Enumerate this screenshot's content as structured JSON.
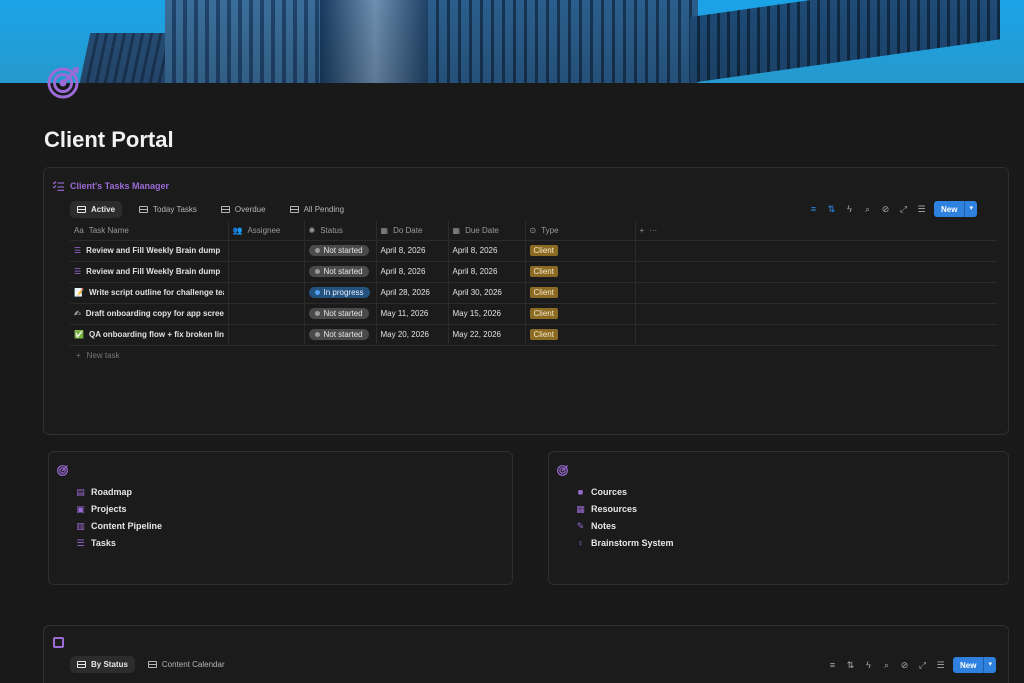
{
  "page": {
    "title": "Client Portal"
  },
  "tasks_db": {
    "title": "Client's Tasks Manager",
    "tabs": [
      {
        "label": "Active",
        "active": true
      },
      {
        "label": "Today Tasks",
        "active": false
      },
      {
        "label": "Overdue",
        "active": false
      },
      {
        "label": "All Pending",
        "active": false
      }
    ],
    "new_label": "New",
    "columns": {
      "name": "Task Name",
      "assignee": "Assignee",
      "status": "Status",
      "do_date": "Do Date",
      "due_date": "Due Date",
      "type": "Type"
    },
    "rows": [
      {
        "icon": "checklist-icon",
        "name": "Review and Fill Weekly Brain dump",
        "status": "Not started",
        "do_date": "April 8, 2026",
        "due_date": "April 8, 2026",
        "type": "Client"
      },
      {
        "icon": "checklist-icon",
        "name": "Review and Fill Weekly Brain dump",
        "status": "Not started",
        "do_date": "April 8, 2026",
        "due_date": "April 8, 2026",
        "type": "Client"
      },
      {
        "icon": "memo-icon",
        "name": "Write script outline for challenge teas",
        "status": "In progress",
        "do_date": "April 28, 2026",
        "due_date": "April 30, 2026",
        "type": "Client"
      },
      {
        "icon": "writing-hand-icon",
        "name": "Draft onboarding copy for app screen",
        "status": "Not started",
        "do_date": "May 11, 2026",
        "due_date": "May 15, 2026",
        "type": "Client"
      },
      {
        "icon": "check-mark-icon",
        "name": "QA onboarding flow + fix broken links",
        "status": "Not started",
        "do_date": "May 20, 2026",
        "due_date": "May 22, 2026",
        "type": "Client"
      }
    ],
    "new_task_label": "New task"
  },
  "nav_left": {
    "links": [
      {
        "label": "Roadmap",
        "icon": "roadmap-icon"
      },
      {
        "label": "Projects",
        "icon": "projects-icon"
      },
      {
        "label": "Content Pipeline",
        "icon": "film-icon"
      },
      {
        "label": "Tasks",
        "icon": "checklist-icon"
      }
    ]
  },
  "nav_right": {
    "links": [
      {
        "label": "Cources",
        "icon": "video-camera-icon"
      },
      {
        "label": "Resources",
        "icon": "archive-icon"
      },
      {
        "label": "Notes",
        "icon": "pen-lines-icon"
      },
      {
        "label": "Brainstorm System",
        "icon": "brain-icon"
      }
    ]
  },
  "board_db": {
    "tabs": [
      {
        "label": "By Status",
        "active": true
      },
      {
        "label": "Content Calendar",
        "active": false
      }
    ],
    "new_label": "New"
  },
  "colors": {
    "accent_purple": "#9b6bd6",
    "primary_blue": "#2f81e0",
    "tag_client": "#8b6a23",
    "status_in_progress": "#24527f",
    "status_not_started": "#4a4a4a"
  }
}
